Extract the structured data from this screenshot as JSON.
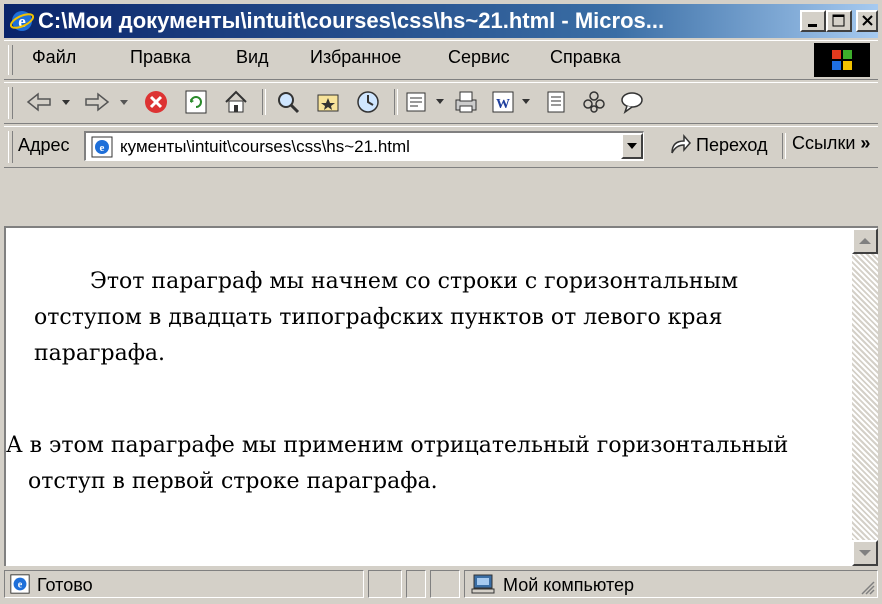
{
  "window": {
    "title": "C:\\Мои документы\\intuit\\courses\\css\\hs~21.html - Micros..."
  },
  "menu": {
    "items": [
      {
        "label": "Файл",
        "key": "Ф"
      },
      {
        "label": "Правка",
        "key": "П"
      },
      {
        "label": "Вид",
        "key": "В"
      },
      {
        "label": "Избранное",
        "key": "И"
      },
      {
        "label": "Сервис",
        "key": "е"
      },
      {
        "label": "Справка",
        "key": "С"
      }
    ]
  },
  "toolbar": {
    "icons": [
      "back-icon",
      "forward-icon",
      "stop-icon",
      "refresh-icon",
      "home-icon",
      "search-icon",
      "favorites-icon",
      "history-icon",
      "mail-icon",
      "print-icon",
      "word-icon",
      "edit-icon",
      "messenger-icon",
      "discuss-icon"
    ]
  },
  "address": {
    "label": "Адрес",
    "value": "кументы\\intuit\\courses\\css\\hs~21.html",
    "go_label": "Переход",
    "links_label": "Ссылки",
    "more": "»"
  },
  "content": {
    "paragraph1": "Этот параграф мы начнем со строки с горизонтальным отступом в двадцать типографских пунктов от левого края параграфа.",
    "paragraph2": "А в этом параграфе мы применим отрицательный горизонтальный отступ в первой строке параграфа."
  },
  "status": {
    "text": "Готово",
    "zone": "Мой компьютер"
  },
  "colors": {
    "title_start": "#0a246a",
    "title_end": "#a6caf0",
    "chrome": "#d4d0c8"
  }
}
